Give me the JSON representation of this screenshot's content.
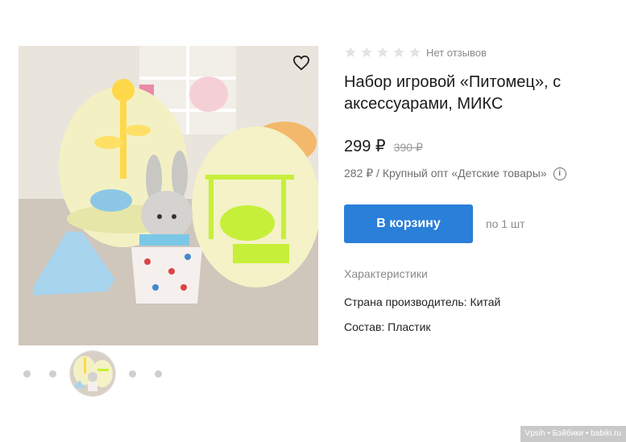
{
  "product": {
    "title": "Набор игровой «Питомец», с аксессуарами, МИКС",
    "reviews_text": "Нет отзывов",
    "rating_stars": 0,
    "price": "299 ₽",
    "old_price": "390 ₽",
    "wholesale": "282 ₽ / Крупный опт «Детские товары»",
    "cart_button": "В корзину",
    "quantity_note": "по 1 шт"
  },
  "specs": {
    "heading": "Характеристики",
    "items": [
      "Страна производитель: Китай",
      "Состав: Пластик"
    ]
  },
  "icons": {
    "favorite": "heart-icon",
    "info": "info-icon",
    "stars": "star-icon"
  },
  "colors": {
    "accent": "#2a7fd8",
    "star_empty": "#e3e3e3"
  },
  "watermark": "Vpsih • Бэйбики • babiki.ru"
}
